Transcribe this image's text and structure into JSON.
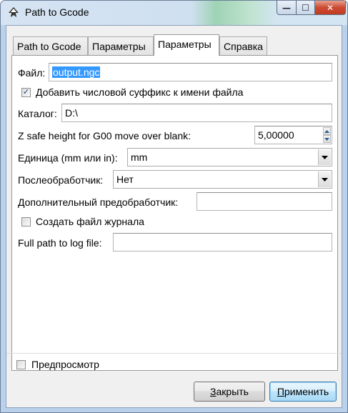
{
  "window": {
    "title": "Path to Gcode"
  },
  "titlebar": {
    "minimize_glyph": "—",
    "maximize_glyph": "☐",
    "close_glyph": "✕"
  },
  "tabs": [
    {
      "label": "Path to Gcode"
    },
    {
      "label": "Параметры"
    },
    {
      "label": "Параметры"
    },
    {
      "label": "Справка"
    }
  ],
  "form": {
    "file_label": "Файл:",
    "file_value": "output.ngc",
    "suffix_checkbox_label": "Добавить числовой суффикс к имени файла",
    "suffix_checked": true,
    "dir_label": "Каталог:",
    "dir_value": "D:\\",
    "zsafe_label": "Z safe height for G00 move over blank:",
    "zsafe_value": "5,00000",
    "unit_label": "Единица (mm или in):",
    "unit_value": "mm",
    "post_label": "Послеобработчик:",
    "post_value": "Нет",
    "pre_label": "Дополнительный предобработчик:",
    "pre_value": "",
    "log_checkbox_label": "Создать файл журнала",
    "log_checked": false,
    "logpath_label": "Full path to log file:",
    "logpath_value": ""
  },
  "footer": {
    "preview_label": "Предпросмотр",
    "preview_checked": false,
    "close_first": "З",
    "close_rest": "акрыть",
    "apply_first": "П",
    "apply_rest": "рименить"
  },
  "colors": {
    "selection": "#3399ff",
    "panel": "#ffffff",
    "dialog": "#f0f0f0"
  }
}
